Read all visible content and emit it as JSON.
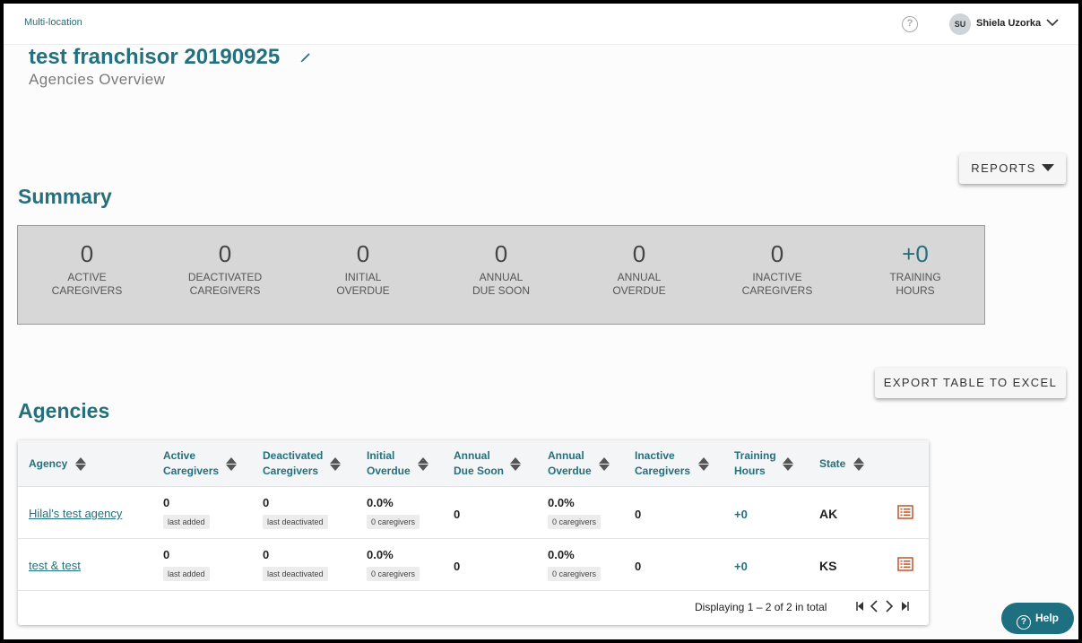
{
  "header": {
    "breadcrumb": "Multi-location",
    "help_glyph": "?",
    "user_initials": "SU",
    "user_name": "Shiela Uzorka"
  },
  "page": {
    "title": "test franchisor 20190925",
    "subtitle": "Agencies Overview"
  },
  "buttons": {
    "reports": "REPORTS",
    "export": "EXPORT TABLE TO EXCEL"
  },
  "summary": {
    "heading": "Summary",
    "stats": [
      {
        "value": "0",
        "label1": "ACTIVE",
        "label2": "CAREGIVERS"
      },
      {
        "value": "0",
        "label1": "DEACTIVATED",
        "label2": "CAREGIVERS"
      },
      {
        "value": "0",
        "label1": "INITIAL",
        "label2": "OVERDUE"
      },
      {
        "value": "0",
        "label1": "ANNUAL",
        "label2": "DUE SOON"
      },
      {
        "value": "0",
        "label1": "ANNUAL",
        "label2": "OVERDUE"
      },
      {
        "value": "0",
        "label1": "INACTIVE",
        "label2": "CAREGIVERS"
      },
      {
        "value": "+0",
        "label1": "TRAINING",
        "label2": "HOURS"
      }
    ]
  },
  "agencies": {
    "heading": "Agencies",
    "columns": [
      {
        "l1": "Agency",
        "l2": ""
      },
      {
        "l1": "Active",
        "l2": "Caregivers"
      },
      {
        "l1": "Deactivated",
        "l2": "Caregivers"
      },
      {
        "l1": "Initial",
        "l2": "Overdue"
      },
      {
        "l1": "Annual",
        "l2": "Due Soon"
      },
      {
        "l1": "Annual",
        "l2": "Overdue"
      },
      {
        "l1": "Inactive",
        "l2": "Caregivers"
      },
      {
        "l1": "Training",
        "l2": "Hours"
      },
      {
        "l1": "State",
        "l2": ""
      }
    ],
    "rows": [
      {
        "agency": "Hilal's test agency",
        "active": "0",
        "active_note": "last added",
        "deactivated": "0",
        "deactivated_note": "last deactivated",
        "initial": "0.0%",
        "initial_note": "0 caregivers",
        "annual_due": "0",
        "annual_overdue": "0.0%",
        "annual_overdue_note": "0 caregivers",
        "inactive": "0",
        "training": "+0",
        "state": "AK"
      },
      {
        "agency": "test & test",
        "active": "0",
        "active_note": "last added",
        "deactivated": "0",
        "deactivated_note": "last deactivated",
        "initial": "0.0%",
        "initial_note": "0 caregivers",
        "annual_due": "0",
        "annual_overdue": "0.0%",
        "annual_overdue_note": "0 caregivers",
        "inactive": "0",
        "training": "+0",
        "state": "KS"
      }
    ],
    "pagination": "Displaying 1 – 2 of 2 in total"
  },
  "help_fab": {
    "label": "Help",
    "glyph": "?"
  },
  "colors": {
    "accent": "#24707c",
    "icon_orange": "#c0552a",
    "summary_bg": "#d7d7d7"
  }
}
